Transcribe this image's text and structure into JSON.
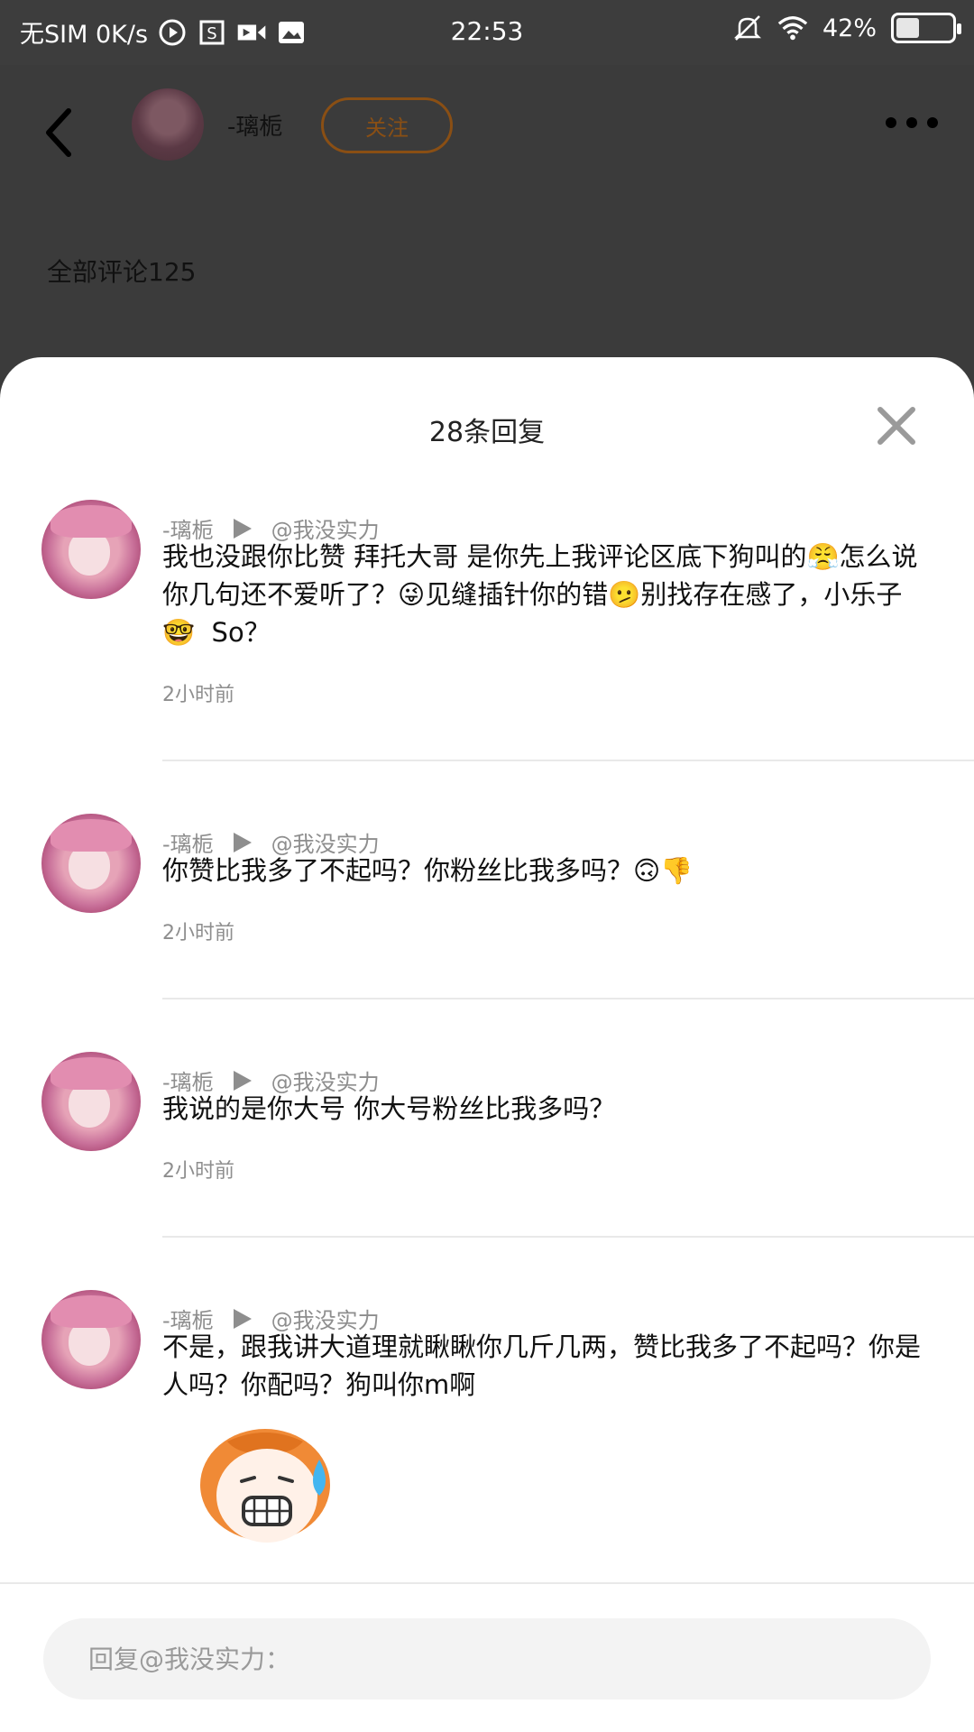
{
  "status_bar": {
    "carrier": "无SIM 0K/s",
    "time": "22:53",
    "battery": "42%",
    "battery_level": 0.42
  },
  "page": {
    "author_name": "-璃栀",
    "follow_label": "关注",
    "all_comments_label": "全部评论125"
  },
  "sheet": {
    "title": "28条回复",
    "replies": [
      {
        "author": "-璃栀",
        "target": "@我没实力",
        "text": "我也没跟你比赞 拜托大哥 是你先上我评论区底下狗叫的😤怎么说你几句还不爱听了？😜见缝插针你的错🫤别找存在感了，小乐子🤓  So？",
        "time": "2小时前"
      },
      {
        "author": "-璃栀",
        "target": "@我没实力",
        "text": "你赞比我多了不起吗？你粉丝比我多吗？🙃👎",
        "time": "2小时前"
      },
      {
        "author": "-璃栀",
        "target": "@我没实力",
        "text": "我说的是你大号 你大号粉丝比我多吗？",
        "time": "2小时前"
      },
      {
        "author": "-璃栀",
        "target": "@我没实力",
        "text": "不是，跟我讲大道理就瞅瞅你几斤几两，赞比我多了不起吗？你是人吗？你配吗？狗叫你m啊",
        "time": ""
      }
    ]
  },
  "input": {
    "placeholder": "回复@我没实力："
  },
  "colors": {
    "accent_follow": "#8a4f14",
    "meta_gray": "#8e8e8e",
    "sheet_bg": "#ffffff",
    "dim_bg": "#3b3b3b"
  }
}
